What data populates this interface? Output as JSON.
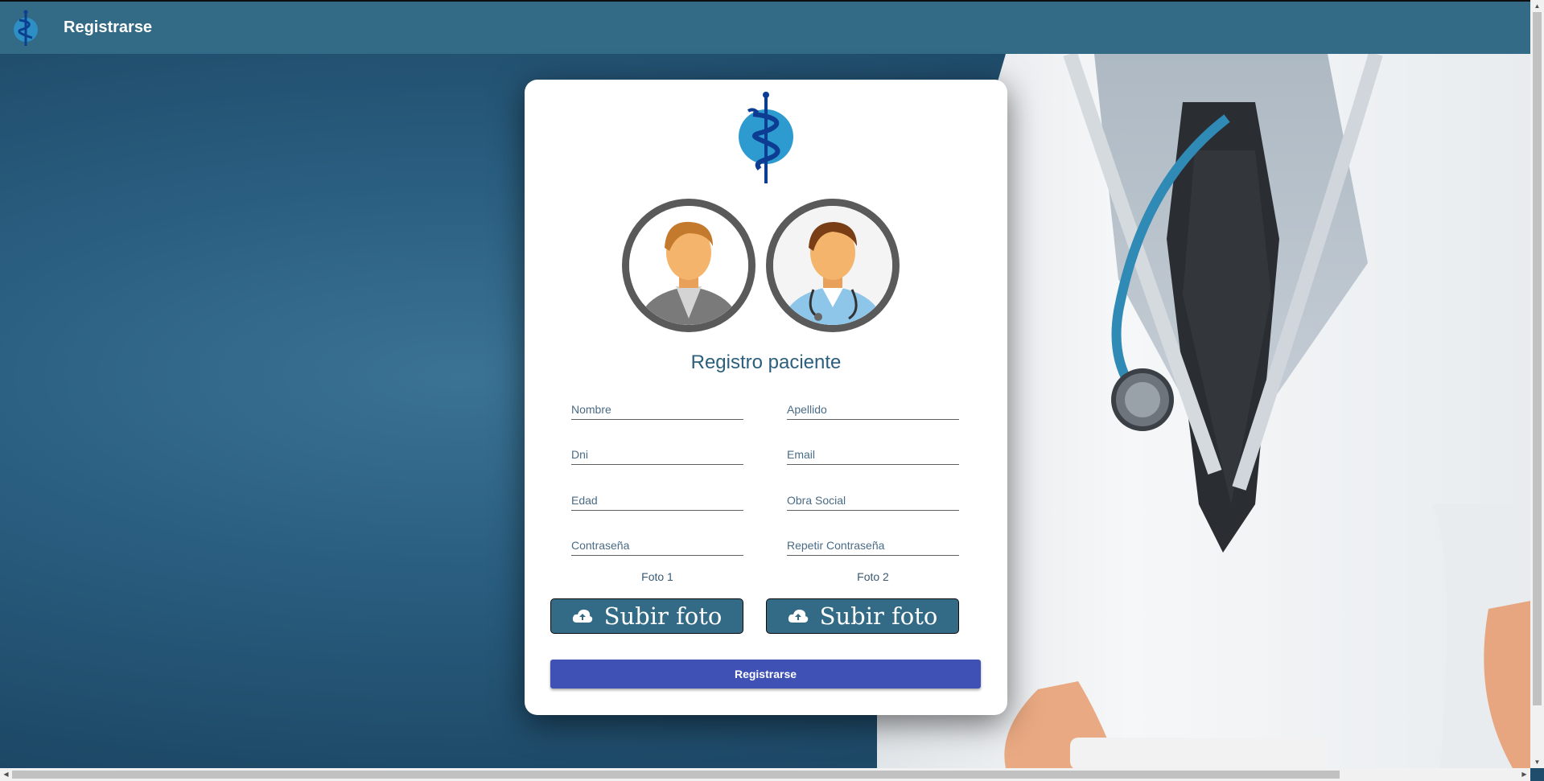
{
  "header": {
    "title": "Registrarse",
    "logo_icon": "caduceus-icon"
  },
  "card": {
    "title": "Registro paciente",
    "avatars": [
      {
        "icon": "patient-avatar-icon"
      },
      {
        "icon": "doctor-avatar-icon"
      }
    ],
    "fields": {
      "nombre": {
        "placeholder": "Nombre",
        "value": ""
      },
      "apellido": {
        "placeholder": "Apellido",
        "value": ""
      },
      "dni": {
        "placeholder": "Dni",
        "value": ""
      },
      "email": {
        "placeholder": "Email",
        "value": ""
      },
      "edad": {
        "placeholder": "Edad",
        "value": ""
      },
      "obra_social": {
        "placeholder": "Obra Social",
        "value": ""
      },
      "password": {
        "placeholder": "Contraseña",
        "value": ""
      },
      "password_repeat": {
        "placeholder": "Repetir Contraseña",
        "value": ""
      }
    },
    "foto1_label": "Foto 1",
    "foto2_label": "Foto 2",
    "upload1_label": "Subir foto",
    "upload2_label": "Subir foto",
    "upload_icon": "cloud-upload-icon",
    "submit_label": "Registrarse"
  },
  "colors": {
    "header_bg": "#336a86",
    "title_text": "#2b5f7d",
    "upload_bg": "#336a86",
    "submit_bg": "#3f51b5"
  }
}
